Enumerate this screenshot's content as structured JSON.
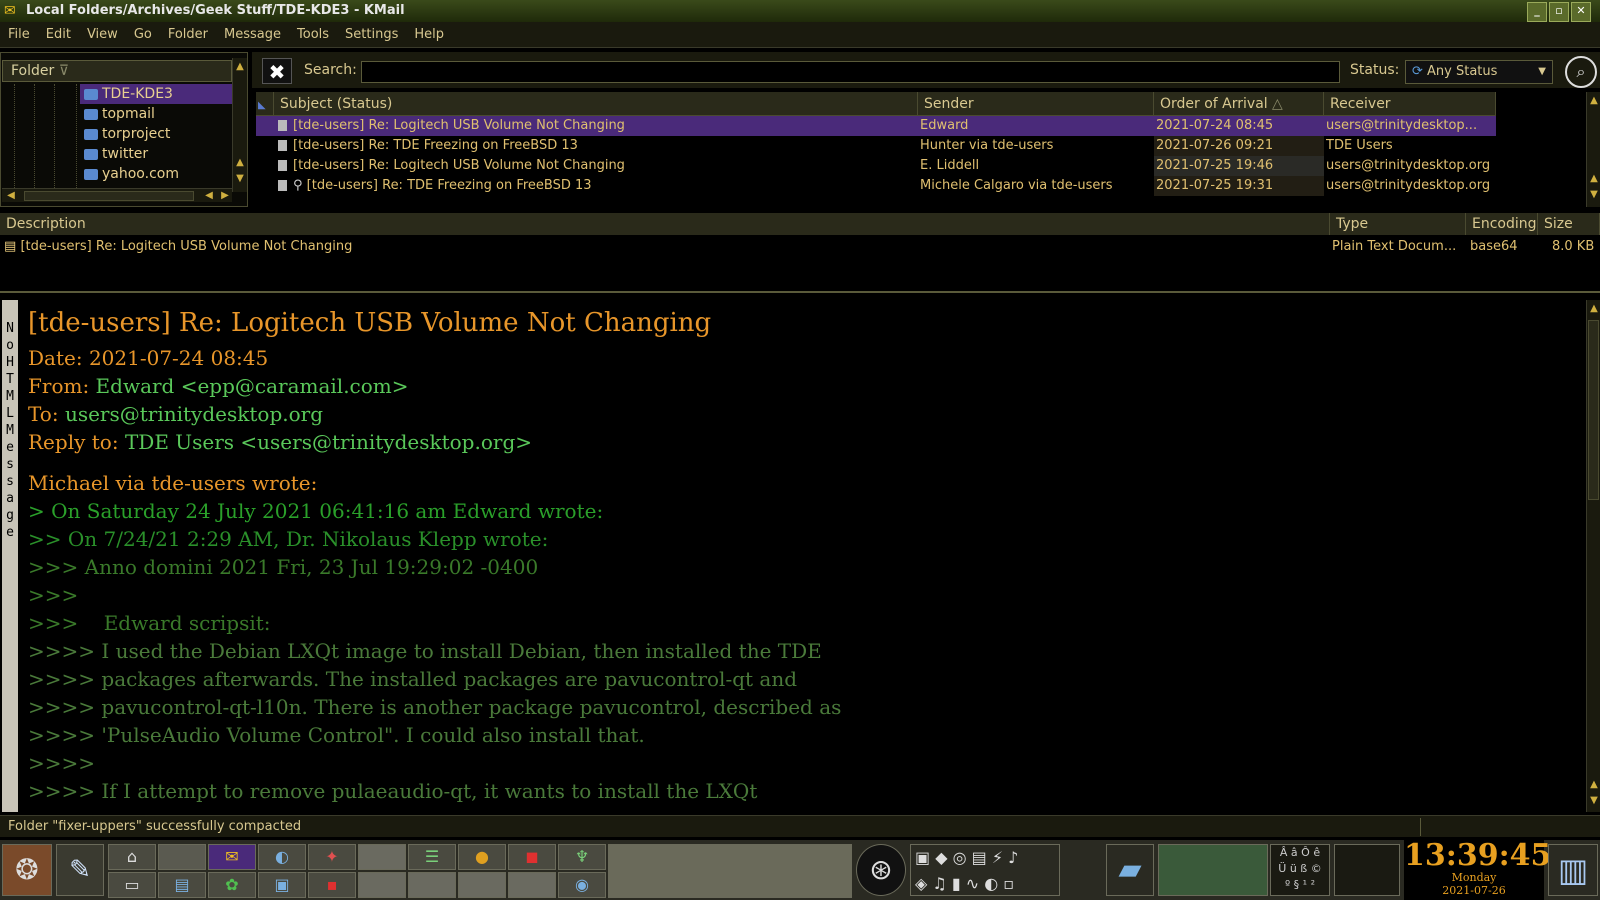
{
  "window": {
    "title": "Local Folders/Archives/Geek Stuff/TDE-KDE3 - KMail"
  },
  "menu": [
    "File",
    "Edit",
    "View",
    "Go",
    "Folder",
    "Message",
    "Tools",
    "Settings",
    "Help"
  ],
  "folders": {
    "header": "Folder",
    "items": [
      {
        "name": "TDE-KDE3",
        "selected": true
      },
      {
        "name": "topmail"
      },
      {
        "name": "torproject"
      },
      {
        "name": "twitter"
      },
      {
        "name": "yahoo.com"
      }
    ]
  },
  "search": {
    "label": "Search:",
    "value": "",
    "status_label": "Status:",
    "status_value": "Any Status"
  },
  "message_list": {
    "columns": [
      "Subject (Status)",
      "Sender",
      "Order of Arrival",
      "Receiver"
    ],
    "rows": [
      {
        "subject": "[tde-users] Re: Logitech USB Volume Not Changing",
        "sender": "Edward",
        "date": "2021-07-24 08:45",
        "receiver": "users@trinitydesktop...",
        "selected": true
      },
      {
        "subject": "[tde-users] Re: TDE Freezing on FreeBSD 13",
        "sender": "Hunter via tde-users",
        "date": "2021-07-26 09:21",
        "receiver": "TDE Users"
      },
      {
        "subject": "[tde-users] Re: Logitech USB Volume Not Changing",
        "sender": "E. Liddell",
        "date": "2021-07-25 19:46",
        "receiver": "users@trinitydesktop.org"
      },
      {
        "subject": "[tde-users] Re: TDE Freezing on FreeBSD 13",
        "sender": "Michele Calgaro via tde-users",
        "date": "2021-07-25 19:31",
        "receiver": "users@trinitydesktop.org"
      }
    ]
  },
  "attachments": {
    "columns": [
      "Description",
      "Type",
      "Encoding",
      "Size"
    ],
    "rows": [
      {
        "description": "[tde-users] Re: Logitech USB Volume Not Changing",
        "type": "Plain Text Docum...",
        "encoding": "base64",
        "size": "8.0 KB"
      }
    ]
  },
  "reader": {
    "sidebar_label": "No HTML Message",
    "subject": "[tde-users] Re: Logitech USB Volume Not Changing",
    "date_label": "Date:",
    "date": "2021-07-24 08:45",
    "from_label": "From:",
    "from": "Edward <epp@caramail.com>",
    "to_label": "To:",
    "to": "users@trinitydesktop.org",
    "reply_label": "Reply to:",
    "reply_to": "TDE Users <users@trinitydesktop.org>",
    "body": [
      "Michael via tde-users wrote:",
      "> On Saturday 24 July 2021 06:41:16 am Edward wrote:",
      ">> On 7/24/21 2:29 AM, Dr. Nikolaus Klepp wrote:",
      ">>> Anno domini 2021 Fri, 23 Jul 19:29:02 -0400",
      ">>>",
      ">>>    Edward scripsit:",
      ">>>> I used the Debian LXQt image to install Debian, then installed the TDE",
      ">>>> packages afterwards. The installed packages are pavucontrol-qt and",
      ">>>> pavucontrol-qt-l10n. There is another package pavucontrol, described as",
      ">>>> 'PulseAudio Volume Control\". I could also install that.",
      ">>>>",
      ">>>> If I attempt to remove pulaeaudio-qt, it wants to install the LXQt"
    ]
  },
  "statusbar": {
    "message": "Folder \"fixer-uppers\" successfully compacted"
  },
  "clock": {
    "time": "13:39:45",
    "day": "Monday",
    "date": "2021-07-26"
  },
  "colors": {
    "selection": "#4a2a7a",
    "accent": "#e8962a",
    "quote": "#2aa02a"
  }
}
